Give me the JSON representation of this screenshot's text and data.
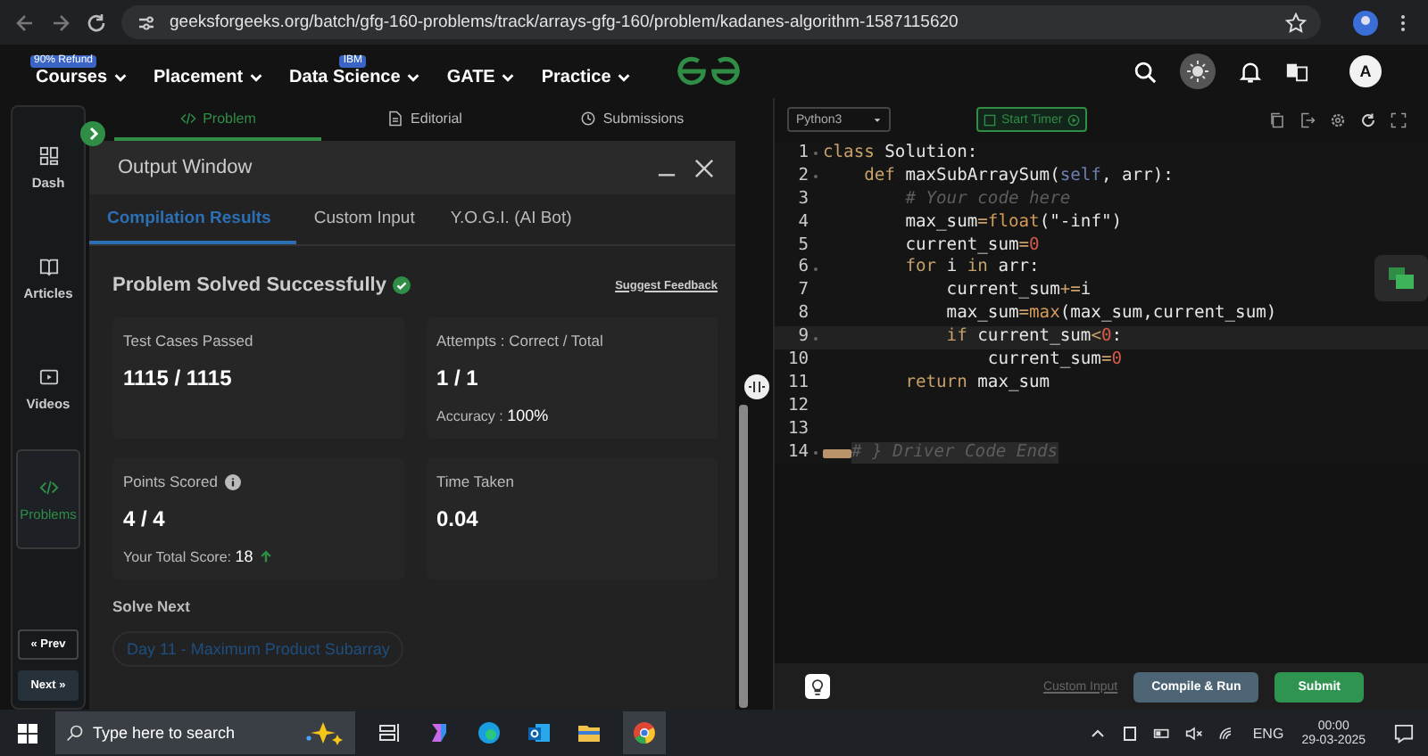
{
  "browser": {
    "url": "geeksforgeeks.org/batch/gfg-160-problems/track/arrays-gfg-160/problem/kadanes-algorithm-1587115620"
  },
  "nav": {
    "items": [
      {
        "label": "Courses",
        "badge": "90% Refund"
      },
      {
        "label": "Placement"
      },
      {
        "label": "Data Science",
        "badge": "IBM"
      },
      {
        "label": "GATE"
      },
      {
        "label": "Practice"
      }
    ],
    "avatar": "A"
  },
  "sidebar": {
    "items": [
      {
        "label": "Dash",
        "kind": "dash",
        "selected": false
      },
      {
        "label": "Articles",
        "kind": "book",
        "selected": false
      },
      {
        "label": "Videos",
        "kind": "video",
        "selected": false
      },
      {
        "label": "Problems",
        "kind": "code",
        "selected": true
      }
    ],
    "prev": "« Prev",
    "next": "Next »"
  },
  "problem_tabs": [
    {
      "label": "Problem",
      "kind": "code",
      "selected": true
    },
    {
      "label": "Editorial",
      "kind": "doc",
      "selected": false
    },
    {
      "label": "Submissions",
      "kind": "clock",
      "selected": false
    }
  ],
  "output": {
    "title": "Output Window",
    "tabs": [
      {
        "label": "Compilation Results",
        "selected": true
      },
      {
        "label": "Custom Input",
        "selected": false
      },
      {
        "label": "Y.O.G.I. (AI Bot)",
        "selected": false
      }
    ],
    "status": "Problem Solved Successfully",
    "feedback": "Suggest Feedback",
    "cards": [
      {
        "title": "Test Cases Passed",
        "value": "1115 / 1115"
      },
      {
        "title": "Attempts : Correct / Total",
        "value": "1 / 1",
        "note_label": "Accuracy : ",
        "note_value": "100%"
      },
      {
        "title": "Points Scored",
        "value": "4 / 4",
        "info": true,
        "note_label": "Your Total Score: ",
        "note_value": "18",
        "trend": true
      },
      {
        "title": "Time Taken",
        "value": "0.04"
      }
    ],
    "solve_next": "Solve Next",
    "next_problem": "Day 11 - Maximum Product Subarray"
  },
  "editor": {
    "language": "Python3",
    "timer": "Start Timer",
    "lines": [
      {
        "number": "1",
        "fold": true,
        "tokens": [
          {
            "text": "class ",
            "kind": "kw"
          },
          {
            "text": "Solution:",
            "kind": "id"
          }
        ]
      },
      {
        "number": "2",
        "fold": true,
        "tokens": [
          {
            "text": "    def ",
            "kind": "kw"
          },
          {
            "text": "maxSubArraySum(",
            "kind": "id"
          },
          {
            "text": "self",
            "kind": "self"
          },
          {
            "text": ", arr):",
            "kind": "id"
          }
        ]
      },
      {
        "number": "3",
        "fold": false,
        "tokens": [
          {
            "text": "        # Your code here",
            "kind": "cmt"
          }
        ]
      },
      {
        "number": "4",
        "fold": false,
        "tokens": [
          {
            "text": "        max_sum",
            "kind": "id"
          },
          {
            "text": "=",
            "kind": "op"
          },
          {
            "text": "float",
            "kind": "fn"
          },
          {
            "text": "(\"-inf\")",
            "kind": "id"
          }
        ]
      },
      {
        "number": "5",
        "fold": false,
        "tokens": [
          {
            "text": "        current_sum",
            "kind": "id"
          },
          {
            "text": "=",
            "kind": "op"
          },
          {
            "text": "0",
            "kind": "num"
          }
        ]
      },
      {
        "number": "6",
        "fold": true,
        "tokens": [
          {
            "text": "        for ",
            "kind": "kw"
          },
          {
            "text": "i ",
            "kind": "id"
          },
          {
            "text": "in ",
            "kind": "kw"
          },
          {
            "text": "arr:",
            "kind": "id"
          }
        ]
      },
      {
        "number": "7",
        "fold": false,
        "tokens": [
          {
            "text": "            current_sum",
            "kind": "id"
          },
          {
            "text": "+=",
            "kind": "op"
          },
          {
            "text": "i",
            "kind": "id"
          }
        ]
      },
      {
        "number": "8",
        "fold": false,
        "tokens": [
          {
            "text": "            max_sum",
            "kind": "id"
          },
          {
            "text": "=",
            "kind": "op"
          },
          {
            "text": "max",
            "kind": "fn"
          },
          {
            "text": "(max_sum,current_sum)",
            "kind": "id"
          }
        ]
      },
      {
        "number": "9",
        "fold": true,
        "active": true,
        "tokens": [
          {
            "text": "            if ",
            "kind": "kw"
          },
          {
            "text": "current_sum",
            "kind": "id"
          },
          {
            "text": "<",
            "kind": "op"
          },
          {
            "text": "0",
            "kind": "num"
          },
          {
            "text": ":",
            "kind": "id"
          }
        ]
      },
      {
        "number": "10",
        "fold": false,
        "tokens": [
          {
            "text": "                current_sum",
            "kind": "id"
          },
          {
            "text": "=",
            "kind": "op"
          },
          {
            "text": "0",
            "kind": "num"
          }
        ]
      },
      {
        "number": "11",
        "fold": false,
        "tokens": [
          {
            "text": "        return ",
            "kind": "kw"
          },
          {
            "text": "max_sum",
            "kind": "id"
          }
        ]
      },
      {
        "number": "12",
        "fold": false
      },
      {
        "number": "13",
        "fold": false
      },
      {
        "number": "14",
        "fold": true,
        "folded": true,
        "tokens": [
          {
            "text": "# } Driver Code Ends",
            "kind": "cmt"
          }
        ]
      }
    ],
    "custom_input": "Custom Input",
    "compile": "Compile & Run",
    "submit": "Submit"
  },
  "taskbar": {
    "search_placeholder": "Type here to search",
    "language": "ENG",
    "time": "00:00",
    "date": "29-03-2025"
  }
}
